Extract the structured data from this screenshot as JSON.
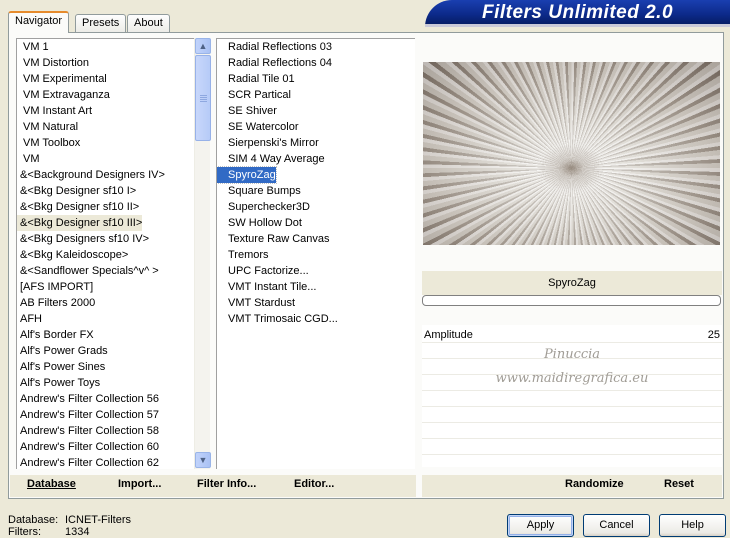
{
  "app": {
    "title": "Filters Unlimited 2.0"
  },
  "tabs": [
    {
      "label": "Navigator",
      "active": true
    },
    {
      "label": "Presets",
      "active": false
    },
    {
      "label": "About",
      "active": false
    }
  ],
  "categories": [
    "VM 1",
    "VM Distortion",
    "VM Experimental",
    "VM Extravaganza",
    "VM Instant Art",
    "VM Natural",
    "VM Toolbox",
    "VM",
    "&<Background Designers IV>",
    "&<Bkg Designer sf10 I>",
    "&<Bkg Designer sf10 II>",
    "&<Bkg Designer sf10 III>",
    "&<Bkg Designers sf10 IV>",
    "&<Bkg Kaleidoscope>",
    "&<Sandflower Specials^v^ >",
    "[AFS IMPORT]",
    "AB Filters 2000",
    "AFH",
    "Alf's Border FX",
    "Alf's Power Grads",
    "Alf's Power Sines",
    "Alf's Power Toys",
    "Andrew's Filter Collection 56",
    "Andrew's Filter Collection 57",
    "Andrew's Filter Collection 58",
    "Andrew's Filter Collection 60",
    "Andrew's Filter Collection 62"
  ],
  "selected_category_index": 11,
  "filters": [
    "Radial Reflections 03",
    "Radial Reflections 04",
    "Radial Tile 01",
    "SCR  Partical",
    "SE Shiver",
    "SE Watercolor",
    "Sierpenski's Mirror",
    "SIM 4 Way Average",
    "SpyroZag",
    "Square Bumps",
    "Superchecker3D",
    "SW Hollow Dot",
    "Texture Raw Canvas",
    "Tremors",
    "UPC Factorize...",
    "VMT Instant Tile...",
    "VMT Stardust",
    "VMT Trimosaic CGD..."
  ],
  "selected_filter_index": 8,
  "filter_name": "SpyroZag",
  "progress": 0,
  "params": [
    {
      "label": "Amplitude",
      "value": "25"
    }
  ],
  "watermark": {
    "line1": "Pinuccia",
    "line2": "www.maidiregrafica.eu"
  },
  "bottom_left_buttons": [
    "Database",
    "Import...",
    "Filter Info...",
    "Editor..."
  ],
  "bottom_right_buttons": [
    "Randomize",
    "Reset"
  ],
  "status": {
    "database_label": "Database:",
    "database_value": "ICNET-Filters",
    "filters_label": "Filters:",
    "filters_value": "1334"
  },
  "dialog_buttons": {
    "apply": "Apply",
    "cancel": "Cancel",
    "help": "Help"
  },
  "scroll_icons": {
    "up": "chevron-up-icon",
    "down": "chevron-down-icon"
  }
}
